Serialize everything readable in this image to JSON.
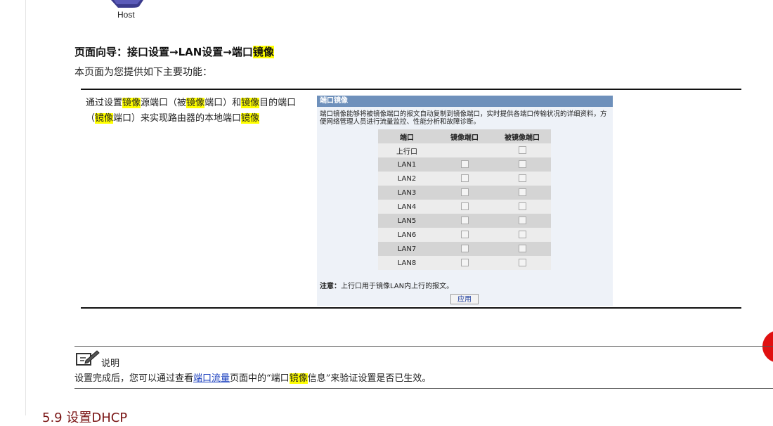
{
  "figure": {
    "host_label": "Host"
  },
  "nav": {
    "prefix": "页面向导：接口设置→LAN设置→端口",
    "highlight": "镜像"
  },
  "intro": "本页面为您提供如下主要功能：",
  "feature": {
    "parts": [
      {
        "t": "通过设置",
        "hl": false
      },
      {
        "t": "镜像",
        "hl": true
      },
      {
        "t": "源端口（被",
        "hl": false
      },
      {
        "t": "镜像",
        "hl": true
      },
      {
        "t": "端口）和",
        "hl": false
      },
      {
        "t": "镜像",
        "hl": true
      },
      {
        "t": "目的端口（",
        "hl": false
      },
      {
        "t": "镜像",
        "hl": true
      },
      {
        "t": "端口）来实现路由器的本地端口",
        "hl": false
      },
      {
        "t": "镜像",
        "hl": true
      }
    ]
  },
  "panel": {
    "title": "端口镜像",
    "description": "端口镜像能够将被镜像端口的报文自动复制到镜像端口，实时提供各端口传输状况的详细资料，方便网络管理人员进行流量监控、性能分析和故障诊断。",
    "columns": [
      "端口",
      "镜像端口",
      "被镜像端口"
    ],
    "rows": [
      {
        "port": "上行口",
        "mirror": false,
        "mirrored": true
      },
      {
        "port": "LAN1",
        "mirror": true,
        "mirrored": true
      },
      {
        "port": "LAN2",
        "mirror": true,
        "mirrored": true
      },
      {
        "port": "LAN3",
        "mirror": true,
        "mirrored": true
      },
      {
        "port": "LAN4",
        "mirror": true,
        "mirrored": true
      },
      {
        "port": "LAN5",
        "mirror": true,
        "mirrored": true
      },
      {
        "port": "LAN6",
        "mirror": true,
        "mirrored": true
      },
      {
        "port": "LAN7",
        "mirror": true,
        "mirrored": true
      },
      {
        "port": "LAN8",
        "mirror": true,
        "mirrored": true
      }
    ],
    "note_label": "注意：",
    "note_text": "上行口用于镜像LAN内上行的报文。",
    "apply_label": "应用"
  },
  "note": {
    "title": "说明",
    "text_before": "设置完成后，您可以通过查看",
    "link": "端口流量",
    "text_mid": "页面中的“端口",
    "highlight": "镜像",
    "text_after": "信息”来验证设置是否已生效。"
  },
  "next_heading": "5.9 设置DHCP",
  "colors": {
    "highlight": "#ffff00",
    "panel_header": "#6e90bb",
    "link": "#1a3fbf",
    "accent_red": "#e01010"
  }
}
